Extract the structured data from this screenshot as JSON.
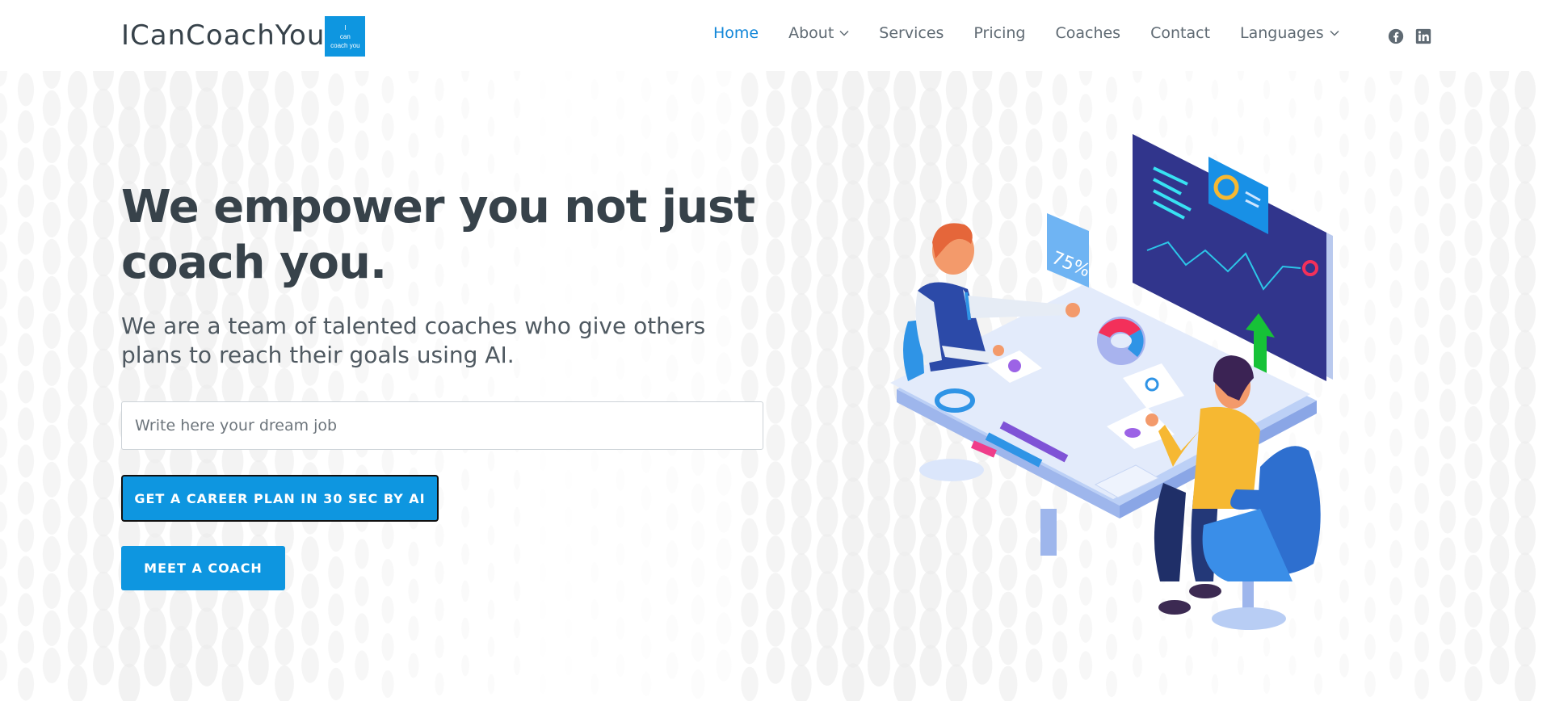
{
  "brand": {
    "name": "ICanCoachYou",
    "badge_line1": "I",
    "badge_line2": "can",
    "badge_line3": "coach you"
  },
  "nav": {
    "home": "Home",
    "about": "About",
    "services": "Services",
    "pricing": "Pricing",
    "coaches": "Coaches",
    "contact": "Contact",
    "languages": "Languages",
    "active": "Home"
  },
  "social": {
    "icons": [
      "facebook-icon",
      "linkedin-icon"
    ]
  },
  "hero": {
    "title": "We empower you not just coach you.",
    "subtitle": "We are a team of talented coaches who give others plans to reach their goals using AI.",
    "input_placeholder": "Write here your dream job",
    "cta_primary": "GET A CAREER PLAN IN 30 SEC BY AI",
    "cta_secondary": "MEET A COACH"
  },
  "illustration": {
    "percent_label": "75%"
  },
  "colors": {
    "accent": "#0e96e0",
    "text": "#37424a",
    "nav_active": "#1186d8"
  }
}
